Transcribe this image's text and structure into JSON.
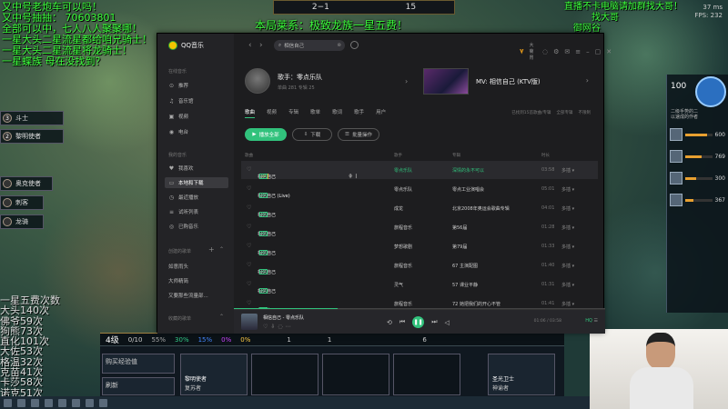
{
  "game": {
    "score": "2−1",
    "gold_count": "15",
    "overlay_center": "本局莱系：极致龙族一星五费！",
    "overlay_left": [
      "又中号老炮车可以吗！",
      "又中号抽抽：  70603801",
      "全部可以中，七人八人聚聚哪！",
      "一星大头二星流星都给咱兄骑士！",
      "一星大头二星流星将龙骑士！",
      "一星蝶族 母在没找到？"
    ],
    "overlay_right": [
      "直播不卡电脑请加群找大哥！",
      "找大哥",
      "御网谷"
    ],
    "fps": [
      "37 ms",
      "FPS: 232"
    ],
    "stats": [
      "一星五费次数",
      "大头140次",
      "佛爷59次",
      "狗熊73次",
      "直化101次",
      "大佐53次",
      "格温32次",
      "克苗41次",
      "卡莎58次",
      "诺克51次"
    ],
    "left_heroes": [
      {
        "level": "3",
        "name": "斗士"
      },
      {
        "level": "2",
        "name": "黎明使者"
      },
      {
        "level": "",
        "name": "奥克使者"
      },
      {
        "level": "",
        "name": "刺客"
      },
      {
        "level": "",
        "name": "龙骑"
      }
    ],
    "right_panel": [
      {
        "hp": "600",
        "fill": 0.82
      },
      {
        "hp": "769",
        "fill": 0.62
      },
      {
        "hp": "300",
        "fill": 0.4
      },
      {
        "hp": "367",
        "fill": 0.3
      }
    ],
    "right_panel_caption": "二级手势的二\n以速成的作者",
    "bottom_level": "4级",
    "bottom_xp": "0/10",
    "bottom_gold": "1",
    "bottom_gold2": "1",
    "bottom_streak": "6",
    "odds": [
      "55%",
      "30%",
      "15%",
      "0%",
      "0%"
    ],
    "shop_cards": [
      {
        "name": "黎明使者",
        "sub": "复苏者"
      },
      {
        "name": "圣光卫士",
        "sub": "神谕者"
      }
    ],
    "buy_xp_label": "购买经验值",
    "refresh_label": "刷新"
  },
  "qq": {
    "app_name": "QQ音乐",
    "search_query": "相信自己",
    "user_label": "大菊胃",
    "sidebar": {
      "online_section": "在线音乐",
      "online_items": [
        {
          "icon": "home-icon",
          "label": "推荐"
        },
        {
          "icon": "music-hall-icon",
          "label": "音乐馆"
        },
        {
          "icon": "video-icon",
          "label": "视频"
        },
        {
          "icon": "radio-icon",
          "label": "电台"
        }
      ],
      "my_section": "我的音乐",
      "my_items": [
        {
          "icon": "heart-icon",
          "label": "我喜欢"
        },
        {
          "icon": "local-download-icon",
          "label": "本地和下载"
        },
        {
          "icon": "recent-play-icon",
          "label": "最近播放"
        },
        {
          "icon": "try-list-icon",
          "label": "试听列表"
        },
        {
          "icon": "purchased-icon",
          "label": "已购音乐"
        }
      ],
      "created_section": "创建的歌单",
      "created_items": [
        "如意雨头",
        "大师精简",
        "又要那些流量部..."
      ],
      "collected_section": "收藏的歌单"
    },
    "singer": {
      "prefix": "歌手：",
      "name": "零点乐队",
      "meta": "单曲  281    专辑  25"
    },
    "mv": {
      "label": "MV: 相信自己 (KTV版)"
    },
    "tabs": [
      "歌曲",
      "视频",
      "专辑",
      "歌单",
      "歌词",
      "歌手",
      "用户"
    ],
    "tab_right": [
      "已找到15首歌曲/专辑",
      "全部专辑",
      "不限制"
    ],
    "buttons": {
      "play_all": "播放全部",
      "download": "下载",
      "batch": "批量操作"
    },
    "columns": {
      "song": "歌曲",
      "artist": "歌手",
      "album": "专辑",
      "duration": "时长"
    },
    "songs": [
      {
        "title": "相信自己",
        "tags": [
          "VIP",
          "MV"
        ],
        "artist": "零点乐队",
        "artist_green": true,
        "album": "深情的永不可以",
        "album_green": true,
        "time": "03:58",
        "highlight": true
      },
      {
        "title": "相信自己 (Live)",
        "tags": [
          "MV"
        ],
        "artist": "零点乐队",
        "album": "零点工业演唱会",
        "time": "05:01"
      },
      {
        "title": "相信自己",
        "tags": [
          "MV"
        ],
        "artist": "成龙",
        "album": "北京2008年奥运会歌曲专辑",
        "time": "04:01"
      },
      {
        "title": "相信自己",
        "tags": [
          "MV"
        ],
        "artist": "旅程音乐",
        "album": "第56届",
        "time": "01:28"
      },
      {
        "title": "相信自己",
        "tags": [
          "MV"
        ],
        "artist": "梦想歌剧",
        "album": "第79届",
        "time": "01:33"
      },
      {
        "title": "相信自己",
        "tags": [
          "MV"
        ],
        "artist": "旅程音乐",
        "album": "67 主演配图",
        "time": "01:40"
      },
      {
        "title": "相信自己",
        "tags": [
          "MV"
        ],
        "artist": "灵气",
        "album": "57 课业平静",
        "time": "01:31"
      },
      {
        "title": "相信自己",
        "tags": [
          "MV"
        ],
        "artist": "旅程音乐",
        "album": "72 她把我们的开心不管",
        "time": "01:41"
      }
    ],
    "more_label": "多插 ▾",
    "player": {
      "title": "相信自己 - 零点乐队",
      "time": "01:06 / 03:58",
      "quality": "HQ",
      "progress": 0.28
    }
  }
}
